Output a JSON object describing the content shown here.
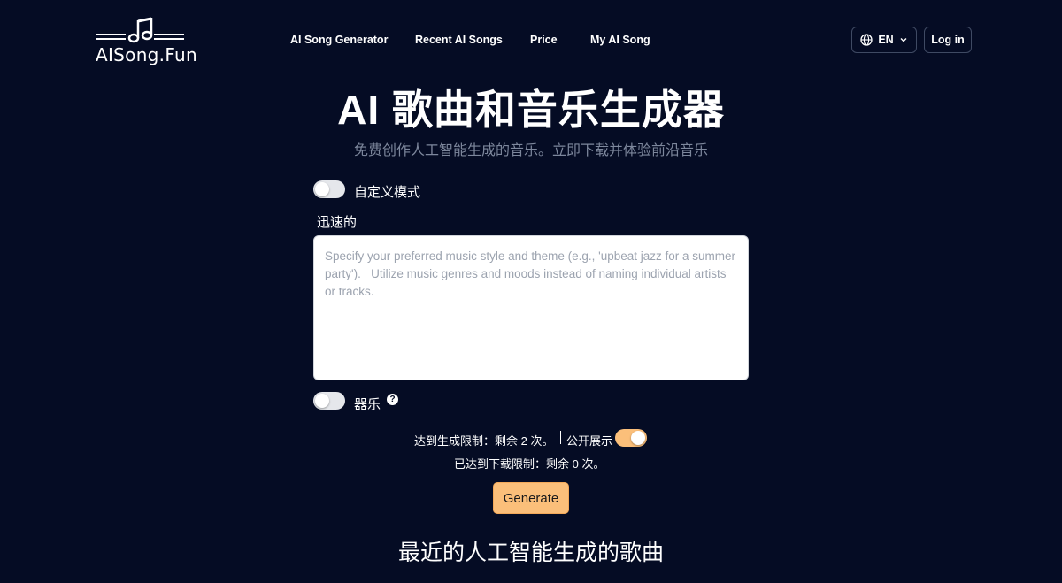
{
  "brand": {
    "name": "AISong.Fun",
    "logo_icon": "music-note-icon"
  },
  "nav": {
    "items": [
      "AI Song Generator",
      "Recent AI Songs",
      "Price",
      "My AI Song"
    ]
  },
  "header": {
    "language": "EN",
    "language_icon": "globe-icon",
    "login_label": "Log in"
  },
  "hero": {
    "title": "AI 歌曲和音乐生成器",
    "subtitle": "免费创作人工智能生成的音乐。立即下载并体验前沿音乐"
  },
  "form": {
    "custom_mode_label": "自定义模式",
    "custom_mode_on": false,
    "prompt_label": "迅速的",
    "prompt_placeholder": "Specify your preferred music style and theme (e.g., 'upbeat jazz for a summer party').   Utilize music genres and moods instead of naming individual artists or tracks.",
    "prompt_value": "",
    "instrumental_label": "器乐",
    "instrumental_on": false,
    "help_icon": "question-circle-icon"
  },
  "limits": {
    "generate_text": "达到生成限制：剩余 2 次。",
    "public_label": "公开展示",
    "public_on": true,
    "download_text": "已达到下载限制：剩余 0 次。"
  },
  "generate_label": "Generate",
  "recent": {
    "title": "最近的人工智能生成的歌曲"
  },
  "colors": {
    "background": "#050c24",
    "accent": "#fbbf7a",
    "subtitle": "#7d879c"
  }
}
